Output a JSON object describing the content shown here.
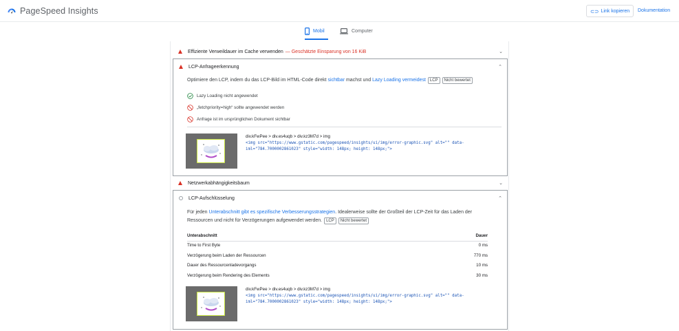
{
  "header": {
    "app_title": "PageSpeed Insights",
    "copy_link_label": "Link kopieren",
    "docs_label": "Dokumentation"
  },
  "tabs": [
    {
      "label": "Mobil",
      "active": true
    },
    {
      "label": "Computer",
      "active": false
    }
  ],
  "audits": {
    "cache": {
      "title": "Effiziente Verweildauer im Cache verwenden",
      "saving": "— Geschätzte Einsparung von 16 KiB"
    },
    "lcp_request": {
      "title": "LCP-Anfrageerkennung",
      "desc_pre": "Optimiere den LCP, indem du das LCP-Bild im HTML-Code direkt ",
      "desc_link1": "sichtbar",
      "desc_mid": " machst und ",
      "desc_link2": "Lazy Loading vermeidest",
      "tag_lcp": "LCP",
      "tag_unrated": "Nicht bewertet",
      "checks": [
        {
          "status": "pass",
          "label": "Lazy Loading nicht angewendet"
        },
        {
          "status": "fail",
          "label": "„fetchpriority=high“ sollte angewendet werden"
        },
        {
          "status": "fail",
          "label": "Anfrage ist im ursprünglichen Dokument sichtbar"
        }
      ],
      "element": {
        "selector": "div.kFwPee > div.es4uqb > div.kz3M7d > img",
        "code_line1": "<img src=\"https://www.gstatic.com/pagespeed/insights/ui/img/error-graphic.svg\" alt=\"\" data-",
        "code_line2": "iml=\"784.7000002861023\" style=\"width: 148px; height: 148px;\">"
      }
    },
    "network": {
      "title": "Netzwerkabhängigkeitsbaum"
    },
    "lcp_breakdown": {
      "title": "LCP-Aufschlüsselung",
      "desc_pre": "Für jeden ",
      "desc_link": "Unterabschnitt gibt es spezifische Verbesserungsstrategien",
      "desc_post": ". Idealerweise sollte der Großteil der LCP-Zeit für das Laden der",
      "desc_line2": "Ressourcen und nicht für Verzögerungen aufgewendet werden.",
      "tag_lcp": "LCP",
      "tag_unrated": "Nicht bewertet",
      "table": {
        "col_subpart": "Unterabschnitt",
        "col_duration": "Dauer",
        "rows": [
          {
            "name": "Time to First Byte",
            "value": "0 ms"
          },
          {
            "name": "Verzögerung beim Laden der Ressourcen",
            "value": "770 ms"
          },
          {
            "name": "Dauer des Ressourcenladevorgangs",
            "value": "10 ms"
          },
          {
            "name": "Verzögerung beim Rendering des Elements",
            "value": "30 ms"
          }
        ]
      },
      "element": {
        "selector": "div.kFwPee > div.es4uqb > div.kz3M7d > img",
        "code_line1": "<img src=\"https://www.gstatic.com/pagespeed/insights/ui/img/error-graphic.svg\" alt=\"\" data-",
        "code_line2": "iml=\"784.7000002861023\" style=\"width: 148px; height: 148px;\">"
      }
    }
  },
  "colors": {
    "accent": "#1a73e8",
    "fail": "#d93025",
    "pass": "#188038"
  }
}
